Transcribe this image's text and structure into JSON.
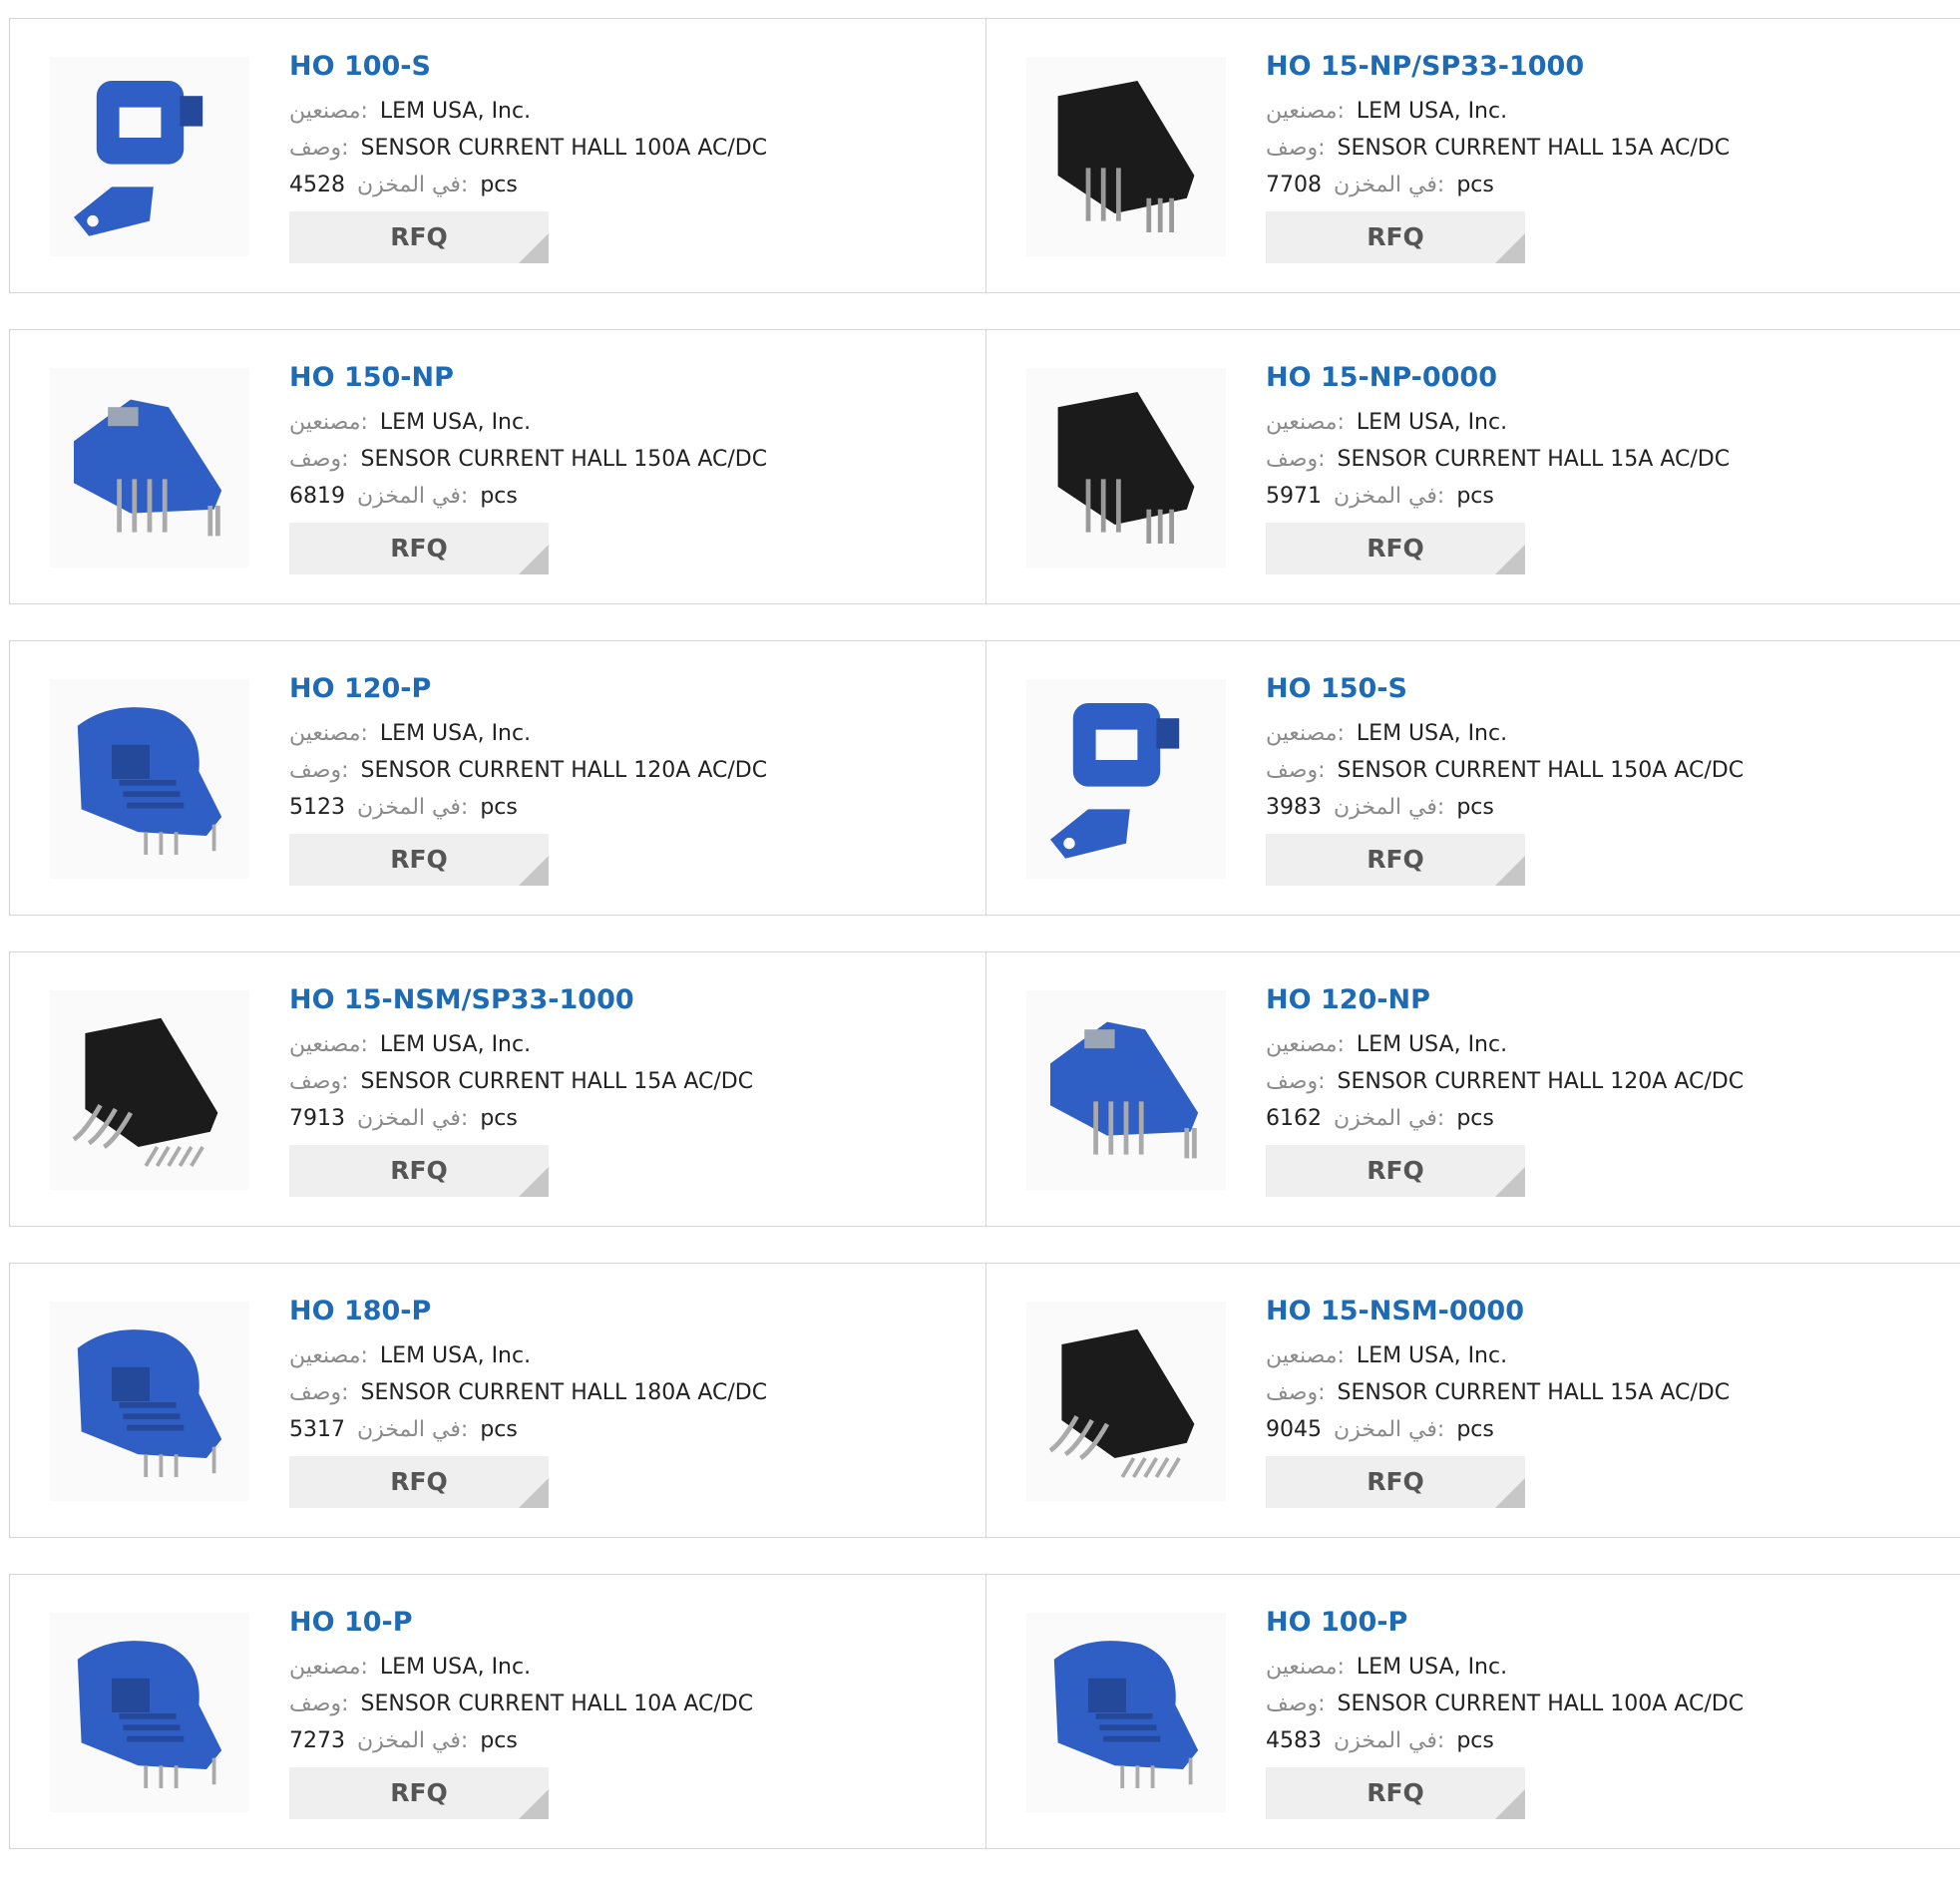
{
  "labels": {
    "manufacturer": "مصنعين:",
    "description": "وصف:",
    "stock": "في المخزن:",
    "unit": "pcs",
    "rfq": "RFQ"
  },
  "colors": {
    "link": "#1e6ab3",
    "blue_part": "#2f5fc4",
    "black_part": "#1b1b1b"
  },
  "products": [
    {
      "name": "HO 100-S",
      "manufacturer": "LEM USA, Inc.",
      "description": "SENSOR CURRENT HALL 100A AC/DC",
      "stock": "4528",
      "image": "blue-clip-sensor"
    },
    {
      "name": "HO 15-NP/SP33-1000",
      "manufacturer": "LEM USA, Inc.",
      "description": "SENSOR CURRENT HALL 15A AC/DC",
      "stock": "7708",
      "image": "black-sensor"
    },
    {
      "name": "HO 150-NP",
      "manufacturer": "LEM USA, Inc.",
      "description": "SENSOR CURRENT HALL 150A AC/DC",
      "stock": "6819",
      "image": "blue-np-sensor"
    },
    {
      "name": "HO 15-NP-0000",
      "manufacturer": "LEM USA, Inc.",
      "description": "SENSOR CURRENT HALL 15A AC/DC",
      "stock": "5971",
      "image": "black-sensor"
    },
    {
      "name": "HO 120-P",
      "manufacturer": "LEM USA, Inc.",
      "description": "SENSOR CURRENT HALL 120A AC/DC",
      "stock": "5123",
      "image": "blue-p-sensor"
    },
    {
      "name": "HO 150-S",
      "manufacturer": "LEM USA, Inc.",
      "description": "SENSOR CURRENT HALL 150A AC/DC",
      "stock": "3983",
      "image": "blue-clip-sensor"
    },
    {
      "name": "HO 15-NSM/SP33-1000",
      "manufacturer": "LEM USA, Inc.",
      "description": "SENSOR CURRENT HALL 15A AC/DC",
      "stock": "7913",
      "image": "black-smd-sensor"
    },
    {
      "name": "HO 120-NP",
      "manufacturer": "LEM USA, Inc.",
      "description": "SENSOR CURRENT HALL 120A AC/DC",
      "stock": "6162",
      "image": "blue-np-sensor"
    },
    {
      "name": "HO 180-P",
      "manufacturer": "LEM USA, Inc.",
      "description": "SENSOR CURRENT HALL 180A AC/DC",
      "stock": "5317",
      "image": "blue-p-sensor"
    },
    {
      "name": "HO 15-NSM-0000",
      "manufacturer": "LEM USA, Inc.",
      "description": "SENSOR CURRENT HALL 15A AC/DC",
      "stock": "9045",
      "image": "black-smd-sensor"
    },
    {
      "name": "HO 10-P",
      "manufacturer": "LEM USA, Inc.",
      "description": "SENSOR CURRENT HALL 10A AC/DC",
      "stock": "7273",
      "image": "blue-p-sensor"
    },
    {
      "name": "HO 100-P",
      "manufacturer": "LEM USA, Inc.",
      "description": "SENSOR CURRENT HALL 100A AC/DC",
      "stock": "4583",
      "image": "blue-p-sensor"
    }
  ]
}
